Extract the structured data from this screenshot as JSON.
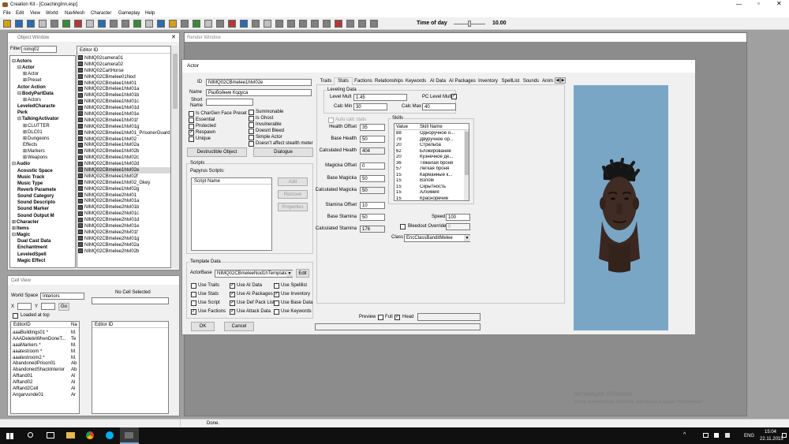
{
  "app": {
    "title": "Creation Kit - [CoachingInn.esp]"
  },
  "menu": [
    "File",
    "Edit",
    "View",
    "World",
    "NavMesh",
    "Character",
    "Gameplay",
    "Help"
  ],
  "time_of_day": {
    "label": "Time of day",
    "value": "10.00"
  },
  "object_window": {
    "title": "Object Window",
    "filter_label": "Filter",
    "filter_value": "nimq02",
    "column_header": "Editor ID",
    "tree": [
      {
        "text": "Actors",
        "indent": 0,
        "bold": true,
        "exp": "⊟"
      },
      {
        "text": "Actor",
        "indent": 1,
        "bold": true,
        "exp": "⊟"
      },
      {
        "text": "Actor",
        "indent": 2,
        "bold": false,
        "exp": "⊞"
      },
      {
        "text": "Preset",
        "indent": 2,
        "bold": false,
        "exp": "⊞"
      },
      {
        "text": "Actor Action",
        "indent": 1,
        "bold": true,
        "exp": ""
      },
      {
        "text": "BodyPartData",
        "indent": 1,
        "bold": true,
        "exp": "⊟"
      },
      {
        "text": "Actors",
        "indent": 2,
        "bold": false,
        "exp": "⊞"
      },
      {
        "text": "LeveledCharacte",
        "indent": 1,
        "bold": true,
        "exp": ""
      },
      {
        "text": "Perk",
        "indent": 1,
        "bold": true,
        "exp": ""
      },
      {
        "text": "TalkingActivator",
        "indent": 1,
        "bold": true,
        "exp": "⊟"
      },
      {
        "text": "CLUTTER",
        "indent": 2,
        "bold": false,
        "exp": "⊞"
      },
      {
        "text": "DLC01",
        "indent": 2,
        "bold": false,
        "exp": "⊞"
      },
      {
        "text": "Dungeons",
        "indent": 2,
        "bold": false,
        "exp": "⊞"
      },
      {
        "text": "Effects",
        "indent": 2,
        "bold": false,
        "exp": ""
      },
      {
        "text": "Markers",
        "indent": 2,
        "bold": false,
        "exp": "⊞"
      },
      {
        "text": "Weapons",
        "indent": 2,
        "bold": false,
        "exp": "⊞"
      },
      {
        "text": "Audio",
        "indent": 0,
        "bold": true,
        "exp": "⊟"
      },
      {
        "text": "Acoustic Space",
        "indent": 1,
        "bold": true,
        "exp": ""
      },
      {
        "text": "Music Track",
        "indent": 1,
        "bold": true,
        "exp": ""
      },
      {
        "text": "Music Type",
        "indent": 1,
        "bold": true,
        "exp": ""
      },
      {
        "text": "Reverb Paramete",
        "indent": 1,
        "bold": true,
        "exp": ""
      },
      {
        "text": "Sound Category",
        "indent": 1,
        "bold": true,
        "exp": ""
      },
      {
        "text": "Sound Descripto",
        "indent": 1,
        "bold": true,
        "exp": ""
      },
      {
        "text": "Sound Marker",
        "indent": 1,
        "bold": true,
        "exp": ""
      },
      {
        "text": "Sound Output M",
        "indent": 1,
        "bold": true,
        "exp": ""
      },
      {
        "text": "Character",
        "indent": 0,
        "bold": true,
        "exp": "⊞"
      },
      {
        "text": "Items",
        "indent": 0,
        "bold": true,
        "exp": "⊞"
      },
      {
        "text": "Magic",
        "indent": 0,
        "bold": true,
        "exp": "⊟"
      },
      {
        "text": "Dual Cast Data",
        "indent": 1,
        "bold": true,
        "exp": ""
      },
      {
        "text": "Enchantment",
        "indent": 1,
        "bold": true,
        "exp": ""
      },
      {
        "text": "LeveledSpell",
        "indent": 1,
        "bold": true,
        "exp": ""
      },
      {
        "text": "Magic Effect",
        "indent": 1,
        "bold": true,
        "exp": ""
      }
    ],
    "items": [
      "NIMQ02camera01",
      "NIMQ02camera02",
      "NIMQ02CartHorse",
      "NIMQ02CBmelee01Nod",
      "NIMQ02CBmelee1hlvl01",
      "NIMQ02CBmelee1hlvl01a",
      "NIMQ02CBmelee1hlvl01b",
      "NIMQ02CBmelee1hlvl01c",
      "NIMQ02CBmelee1hlvl01d",
      "NIMQ02CBmelee1hlvl01e",
      "NIMQ02CBmelee1hlvl01f",
      "NIMQ02CBmelee1hlvl01g",
      "NIMQ02CBmelee1hlvl01_PrisonerGuard",
      "NIMQ02CBmelee1hlvl02",
      "NIMQ02CBmelee1hlvl02a",
      "NIMQ02CBmelee1hlvl02b",
      "NIMQ02CBmelee1hlvl02c",
      "NIMQ02CBmelee1hlvl02d",
      "NIMQ02CBmelee1hlvl02e",
      "NIMQ02CBmelee1hlvl02f",
      "NIMQ02CBmelee1hlvl02_Gkey",
      "NIMQ02CBmelee1hlvl02g",
      "NIMQ02CBmelee2hlvl01",
      "NIMQ02CBmelee2hlvl01a",
      "NIMQ02CBmelee2hlvl01b",
      "NIMQ02CBmelee2hlvl01c",
      "NIMQ02CBmelee2hlvl01d",
      "NIMQ02CBmelee2hlvl01e",
      "NIMQ02CBmelee2hlvl01f",
      "NIMQ02CBmelee2hlvl01g",
      "NIMQ02CBmelee2hlvl02a",
      "NIMQ02CBmelee2hlvl02b"
    ],
    "selected_index": 18
  },
  "cell_view": {
    "title": "Cell View",
    "world_space_label": "World Space",
    "world_space_value": "Interiors",
    "no_cell": "No Cell Selected",
    "x_label": "X",
    "y_label": "Y",
    "go": "Go",
    "loaded_at_top": "Loaded at top",
    "col_editor": "EditorID",
    "col_n": "Na",
    "col_editor2": "Editor ID",
    "rows": [
      [
        "aaaBuildings01 *",
        "M."
      ],
      [
        "AAADeleteWhenDoneT...",
        "Te"
      ],
      [
        "aaaMarkers *",
        "M."
      ],
      [
        "aaatestroom *",
        "M."
      ],
      [
        "aaatestroom2 *",
        "M."
      ],
      [
        "AbandonedPrison01",
        "Ab"
      ],
      [
        "AbandonedShackInterior",
        "Ab"
      ],
      [
        "Alftand01",
        "Al"
      ],
      [
        "Alftand02",
        "Al"
      ],
      [
        "Alftand2Cell",
        "Al"
      ],
      [
        "Angarvunde01",
        "Ar"
      ]
    ]
  },
  "render_window": {
    "title": "Render Window"
  },
  "actor_dialog": {
    "title": "Actor",
    "id_label": "ID",
    "id_value": "NIMQ02CBmelee1hlvl02e",
    "name_label": "Name",
    "name_value": "Разбойник Кодуса",
    "short_label": "Short",
    "short_label2": "Name",
    "checks_left": [
      {
        "label": "Is CharGen Face Preset",
        "checked": false
      },
      {
        "label": "Essential",
        "checked": false
      },
      {
        "label": "Protected",
        "checked": false
      },
      {
        "label": "Respawn",
        "checked": true
      },
      {
        "label": "Unique",
        "checked": false
      }
    ],
    "checks_right": [
      {
        "label": "Summonable",
        "checked": false
      },
      {
        "label": "Is Ghost",
        "checked": false
      },
      {
        "label": "Invulnerable",
        "checked": false
      },
      {
        "label": "Doesnt Bleed",
        "checked": false
      },
      {
        "label": "Simple Actor",
        "checked": false
      },
      {
        "label": "Doesn't affect stealth meter",
        "checked": false
      }
    ],
    "destructible": "Destructible Object",
    "dialogue": "Dialogue",
    "scripts_group": "Scripts",
    "papyrus": "Papyrus Scripts:",
    "script_name": "Script Name",
    "add": "Add",
    "remove": "Remove",
    "properties": "Properties",
    "template_group": "Template Data",
    "actorbase_label": "ActorBase",
    "actorbase_value": "NIMQ02CBmeleeNod1hTemplate",
    "edit": "Edit",
    "template_checks": [
      [
        {
          "label": "Use Traits",
          "checked": false
        },
        {
          "label": "Use AI Data",
          "checked": true
        },
        {
          "label": "Use Spelllist",
          "checked": false
        }
      ],
      [
        {
          "label": "Use Stats",
          "checked": false
        },
        {
          "label": "Use AI Packages",
          "checked": true
        },
        {
          "label": "Use Inventory",
          "checked": true
        }
      ],
      [
        {
          "label": "Use Script",
          "checked": false
        },
        {
          "label": "Use Def Pack List",
          "checked": true
        },
        {
          "label": "Use Base Data",
          "checked": false
        }
      ],
      [
        {
          "label": "Use Factions",
          "checked": true
        },
        {
          "label": "Use Attack Data",
          "checked": true
        },
        {
          "label": "Use Keywords",
          "checked": false
        }
      ]
    ],
    "ok": "OK",
    "cancel": "Cancel",
    "tabs": [
      "Traits",
      "Stats",
      "Factions",
      "Relationships",
      "Keywords",
      "AI Data",
      "AI Packages",
      "Inventory",
      "SpellList",
      "Sounds",
      "Anim"
    ],
    "active_tab": 1,
    "stats": {
      "leveling_group": "Leveling Data",
      "level_mult_label": "Level Mult",
      "level_mult": "1.45",
      "pc_level_mult": "PC Level Mult",
      "calc_min_label": "Calc Min",
      "calc_min": "30",
      "calc_max_label": "Calc Max",
      "calc_max": "40",
      "auto_calc": "Auto calc stats",
      "fields": [
        {
          "label": "Health Offset",
          "value": "35"
        },
        {
          "label": "Base Health",
          "value": "50"
        },
        {
          "label": "Calculated Health",
          "value": "404"
        },
        {
          "label": "Magicka Offset",
          "value": "0"
        },
        {
          "label": "Base Magicka",
          "value": "50"
        },
        {
          "label": "Calculated Magicka",
          "value": "50"
        },
        {
          "label": "Stamina Offset",
          "value": "10"
        },
        {
          "label": "Base Stamina",
          "value": "50"
        },
        {
          "label": "Calculated Stamina",
          "value": "176"
        }
      ],
      "skills_group": "Skills",
      "skills_col_value": "Value",
      "skills_col_name": "Skill Name",
      "skills": [
        [
          "88",
          "Одноручное о..."
        ],
        [
          "79",
          "Двуручное ор..."
        ],
        [
          "20",
          "Стрельба"
        ],
        [
          "62",
          "Блокирование"
        ],
        [
          "20",
          "Кузнечное де..."
        ],
        [
          "36",
          "Тяжелая броня"
        ],
        [
          "57",
          "Легкая броня"
        ],
        [
          "15",
          "Карманные к..."
        ],
        [
          "15",
          "Взлом"
        ],
        [
          "15",
          "Скрытность"
        ],
        [
          "15",
          "Алхимия"
        ],
        [
          "15",
          "Красноречие"
        ]
      ],
      "speed_label": "Speed",
      "speed": "100",
      "bleedout_label": "Bleedout Override",
      "bleedout": "0",
      "class_label": "Class",
      "class_value": "EncClassBanditMelee"
    },
    "preview_label": "Preview",
    "full_label": "Full",
    "head_label": "Head"
  },
  "status_bar": {
    "text": "Done."
  },
  "watermark": {
    "line1": "Активация Windows",
    "line2": "Чтобы активировать Windows, перейдите в раздел \"Параметры\"."
  },
  "taskbar": {
    "lang": "ENG",
    "time": "15:04",
    "date": "22.11.2015"
  }
}
